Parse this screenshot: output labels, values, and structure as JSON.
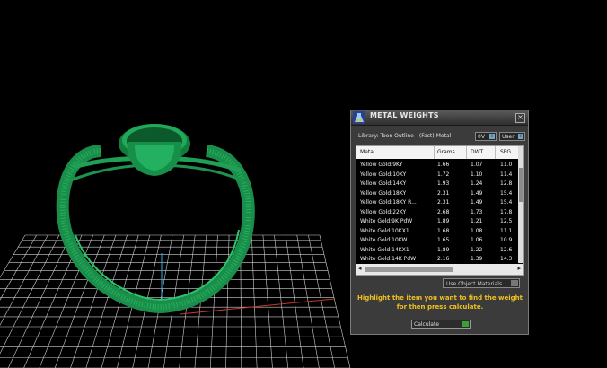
{
  "colors": {
    "background": "#000000",
    "ring": "#1fa055",
    "grid": "#cfcfcf",
    "panel": "#3b3b3b",
    "hint": "#f0c020"
  },
  "viewport": {
    "object": "ring-model"
  },
  "panel": {
    "title": "METAL WEIGHTS",
    "close_glyph": "×",
    "library": "Library: Toon Outline - (Fast)-Metal",
    "unit_1": "0V",
    "unit_1_indicator": "i",
    "unit_2": "User",
    "unit_2_indicator": "i",
    "table": {
      "columns": [
        "Metal",
        "Grams",
        "DWT",
        "SPG"
      ],
      "rows": [
        [
          "Yellow Gold:9KY",
          "1.66",
          "1.07",
          "11.0"
        ],
        [
          "Yellow Gold:10KY",
          "1.72",
          "1.10",
          "11.4"
        ],
        [
          "Yellow Gold:14KY",
          "1.93",
          "1.24",
          "12.8"
        ],
        [
          "Yellow Gold:18KY",
          "2.31",
          "1.49",
          "15.4"
        ],
        [
          "Yellow Gold:18KY R...",
          "2.31",
          "1.49",
          "15.4"
        ],
        [
          "Yellow Gold:22KY",
          "2.68",
          "1.73",
          "17.8"
        ],
        [
          "White Gold:9K PdW",
          "1.89",
          "1.21",
          "12.5"
        ],
        [
          "White Gold:10KX1",
          "1.68",
          "1.08",
          "11.1"
        ],
        [
          "White Gold:10KW",
          "1.65",
          "1.06",
          "10.9"
        ],
        [
          "White Gold:14KX1",
          "1.89",
          "1.22",
          "12.6"
        ],
        [
          "White Gold:14K PdW",
          "2.16",
          "1.39",
          "14.3"
        ]
      ]
    },
    "scroll_left": "◂",
    "scroll_right": "▸",
    "use_object_materials": "Use Object Materials",
    "hint_line_1": "Highlight the item you want to find the weight",
    "hint_line_2": "for then press calculate.",
    "calculate": "Calculate"
  }
}
